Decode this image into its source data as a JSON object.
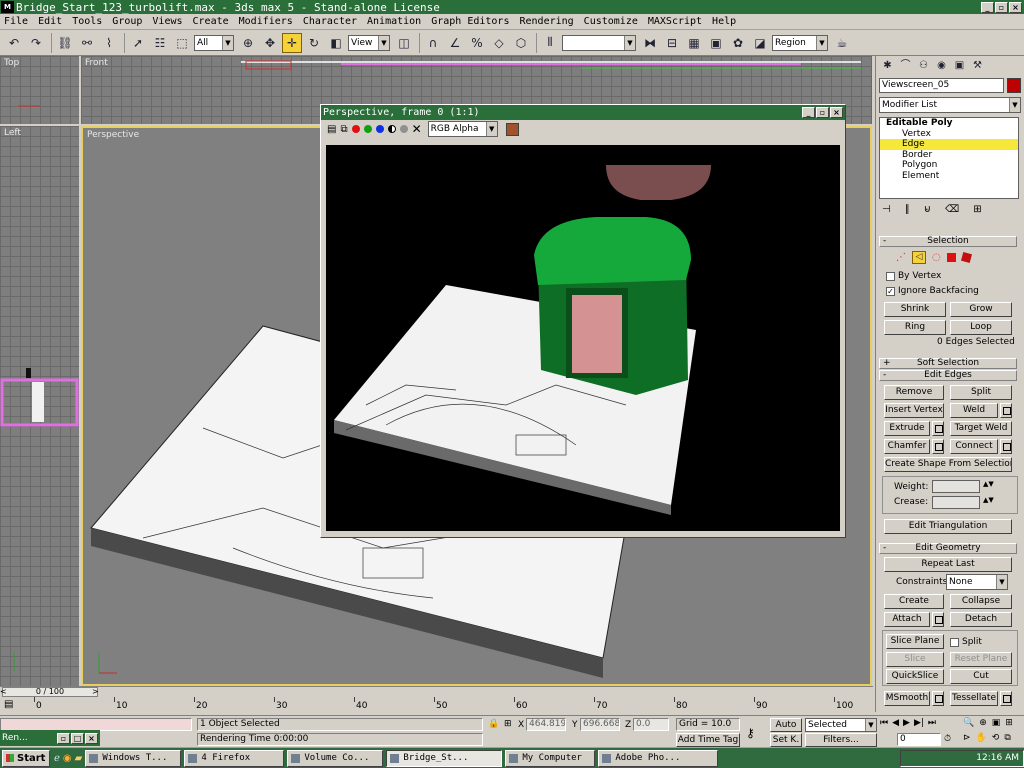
{
  "window": {
    "title": "Bridge_Start_123_turbolift.max - 3ds max 5 - Stand-alone License",
    "min": "_",
    "max": "▫",
    "close": "×"
  },
  "menu": [
    "File",
    "Edit",
    "Tools",
    "Group",
    "Views",
    "Create",
    "Modifiers",
    "Character",
    "Animation",
    "Graph Editors",
    "Rendering",
    "Customize",
    "MAXScript",
    "Help"
  ],
  "toolbar": {
    "filter_value": "All",
    "coord_value": "View",
    "named_sel_value": "",
    "region_value": "Region"
  },
  "viewports": {
    "top": "Top",
    "front": "Front",
    "left": "Left",
    "perspective": "Perspective"
  },
  "render_window": {
    "title": "Perspective, frame 0 (1:1)",
    "channel": "RGB Alpha",
    "swatch_color": "#a0522d"
  },
  "command_panel": {
    "object_name": "Viewscreen_05",
    "object_color": "#c00000",
    "modifier_list": "Modifier List",
    "stack": [
      "Editable Poly",
      "Vertex",
      "Edge",
      "Border",
      "Polygon",
      "Element"
    ],
    "stack_selected": "Edge",
    "selection": {
      "title": "Selection",
      "by_vertex": "By Vertex",
      "ignore_backfacing": "Ignore Backfacing",
      "shrink": "Shrink",
      "grow": "Grow",
      "ring": "Ring",
      "loop": "Loop",
      "status": "0 Edges Selected"
    },
    "soft_selection": {
      "title": "Soft Selection",
      "pm": "+"
    },
    "edit_edges": {
      "title": "Edit Edges",
      "pm": "-",
      "remove": "Remove",
      "split": "Split",
      "insert_vertex": "Insert Vertex",
      "weld": "Weld",
      "extrude": "Extrude",
      "target_weld": "Target Weld",
      "chamfer": "Chamfer",
      "connect": "Connect",
      "create_shape": "Create Shape From Selection",
      "weight": "Weight:",
      "crease": "Crease:",
      "edit_triangulation": "Edit Triangulation"
    },
    "edit_geometry": {
      "title": "Edit Geometry",
      "pm": "-",
      "repeat_last": "Repeat Last",
      "constraints_label": "Constraints:",
      "constraints_value": "None",
      "create": "Create",
      "collapse": "Collapse",
      "attach": "Attach",
      "detach": "Detach",
      "slice_plane": "Slice Plane",
      "split": "Split",
      "slice": "Slice",
      "reset_plane": "Reset Plane",
      "quickslice": "QuickSlice",
      "cut": "Cut",
      "msmooth": "MSmooth",
      "tessellate": "Tessellate"
    },
    "selection_pm": "-"
  },
  "timeline": {
    "frame_display": "0 / 100",
    "ticks": [
      "0",
      "10",
      "20",
      "30",
      "40",
      "50",
      "60",
      "70",
      "80",
      "90",
      "100"
    ]
  },
  "status": {
    "maxscript_label": "Ren...",
    "selected_text": "1 Object Selected",
    "prompt_text": "Rendering Time  0:00:00",
    "x_label": "X",
    "x_value": "464.819",
    "y_label": "Y",
    "y_value": "696.668",
    "z_label": "Z",
    "z_value": "0.0",
    "grid": "Grid = 10.0",
    "add_time_tag": "Add Time Tag",
    "auto_key": "Auto",
    "set_key": "Set K.",
    "selected_dropdown": "Selected",
    "filters": "Filters...",
    "frame_field": "0"
  },
  "taskbar": {
    "start": "Start",
    "tasks": [
      "Windows T...",
      "4 Firefox",
      "Volume Co...",
      "Bridge_St...",
      "My Computer",
      "Adobe Pho..."
    ],
    "active_task": "Bridge_St...",
    "clock": "12:16 AM"
  }
}
